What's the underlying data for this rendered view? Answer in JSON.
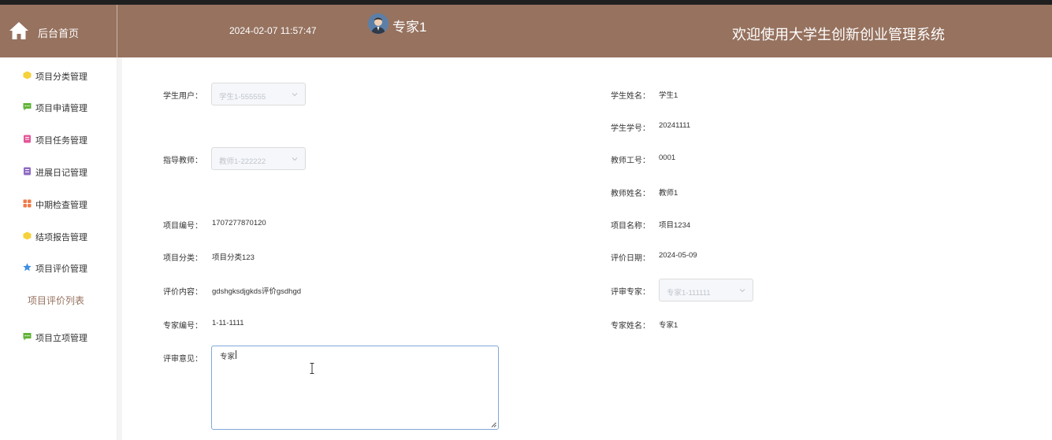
{
  "header": {
    "home_label": "后台首页",
    "datetime": "2024-02-07 11:57:47",
    "user_name": "专家1",
    "site_title": "欢迎使用大学生创新创业管理系统"
  },
  "sidebar": {
    "items": [
      {
        "label": "项目分类管理",
        "icon": "cube-icon",
        "color": "#f5d13b"
      },
      {
        "label": "项目申请管理",
        "icon": "chat-icon",
        "color": "#5fb336"
      },
      {
        "label": "项目任务管理",
        "icon": "clipboard-icon",
        "color": "#e2589a"
      },
      {
        "label": "进展日记管理",
        "icon": "notebook-icon",
        "color": "#8f6bc4"
      },
      {
        "label": "中期检查管理",
        "icon": "grid-icon",
        "color": "#ef7a48"
      },
      {
        "label": "结项报告管理",
        "icon": "cube-icon",
        "color": "#f5d13b"
      },
      {
        "label": "项目评价管理",
        "icon": "star-icon",
        "color": "#3d8fe0"
      },
      {
        "label": "项目立项管理",
        "icon": "chat-icon",
        "color": "#5fb336"
      }
    ],
    "sub_item": "项目评价列表"
  },
  "form": {
    "student_user_label": "学生用户：",
    "student_user_value": "学生1-555555",
    "student_name_label": "学生姓名：",
    "student_name_value": "学生1",
    "student_no_label": "学生学号：",
    "student_no_value": "20241111",
    "teacher_label": "指导教师：",
    "teacher_value": "教师1-222222",
    "teacher_no_label": "教师工号：",
    "teacher_no_value": "0001",
    "teacher_name_label": "教师姓名：",
    "teacher_name_value": "教师1",
    "project_no_label": "项目编号：",
    "project_no_value": "1707277870120",
    "project_name_label": "项目名称：",
    "project_name_value": "项目1234",
    "project_category_label": "项目分类：",
    "project_category_value": "项目分类123",
    "eval_date_label": "评价日期：",
    "eval_date_value": "2024-05-09",
    "eval_content_label": "评价内容：",
    "eval_content_value": "gdshgksdjgkds评价gsdhgd",
    "reviewer_label": "评审专家：",
    "reviewer_value": "专家1-111111",
    "expert_no_label": "专家编号：",
    "expert_no_value": "1-11-1111",
    "expert_name_label": "专家姓名：",
    "expert_name_value": "专家1",
    "opinion_label": "评审意见：",
    "opinion_value": "专家"
  },
  "colors": {
    "header_bg": "#96725f",
    "accent": "#96725f",
    "focus_border": "#7fa8d9"
  }
}
